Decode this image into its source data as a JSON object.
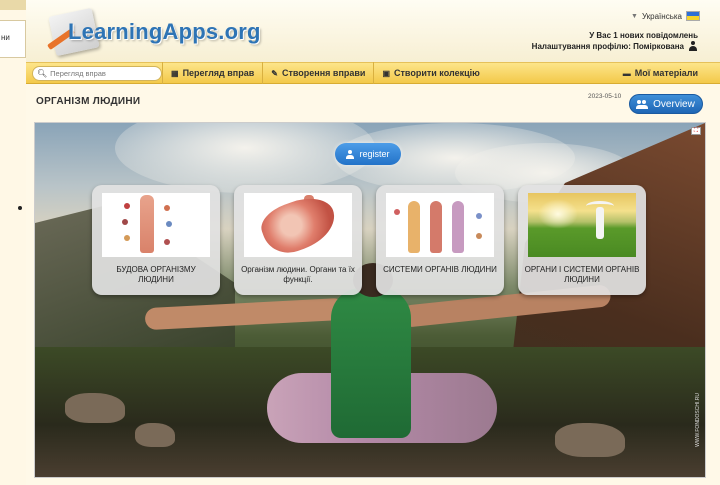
{
  "left_stub": {
    "text": "ни"
  },
  "header": {
    "logo_text": "LearningApps.org",
    "language": "Українська",
    "messages": "У Вас 1 нових повідомлень",
    "profile": "Налаштування профілю: Поміркована"
  },
  "nav": {
    "search_placeholder": "Перегляд вправ",
    "browse": "Перегляд вправ",
    "create": "Створення вправи",
    "collection": "Створити колекцію",
    "my_materials": "Мої матеріали"
  },
  "page": {
    "title": "ОРГАНІЗМ ЛЮДИНИ",
    "date": "2023-05-10",
    "overview": "Overview",
    "register": "register"
  },
  "cards": [
    {
      "caption": "БУДОВА ОРГАНІЗМУ ЛЮДИНИ"
    },
    {
      "caption": "Організм людини. Органи та їх функції."
    },
    {
      "caption": "СИСТЕМИ ОРГАНІВ ЛЮДИНИ"
    },
    {
      "caption": "ОРГАНИ І СИСТЕМИ ОРГАНІВ ЛЮДИНИ"
    }
  ],
  "watermark": "WWW.FONDOSCHI.RU",
  "colors": {
    "nav_bar": "#f3c94a",
    "logo_blue": "#2e74b5",
    "button_blue": "#2272c8",
    "page_bg": "#fff9e8"
  },
  "icons": [
    "search-icon",
    "grid-icon",
    "pencil-icon",
    "collection-icon",
    "folder-icon",
    "user-icon",
    "people-icon",
    "fullscreen-icon"
  ]
}
